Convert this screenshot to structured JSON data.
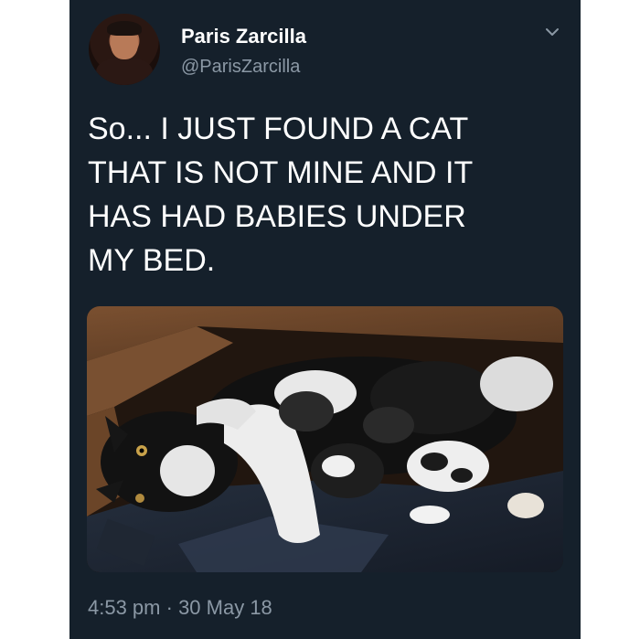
{
  "tweet": {
    "author": {
      "display_name": "Paris Zarcilla",
      "handle": "@ParisZarcilla"
    },
    "menu_icon": "chevron-down-icon",
    "text": "So... I JUST FOUND A CAT\nTHAT IS NOT MINE AND IT\nHAS HAD BABIES UNDER\nMY BED.",
    "media": {
      "type": "photo"
    },
    "time": "4:53 pm",
    "separator": " · ",
    "date": "30 May 18"
  },
  "colors": {
    "background": "#15202b",
    "primary_text": "#ffffff",
    "secondary_text": "#8b98a5"
  }
}
